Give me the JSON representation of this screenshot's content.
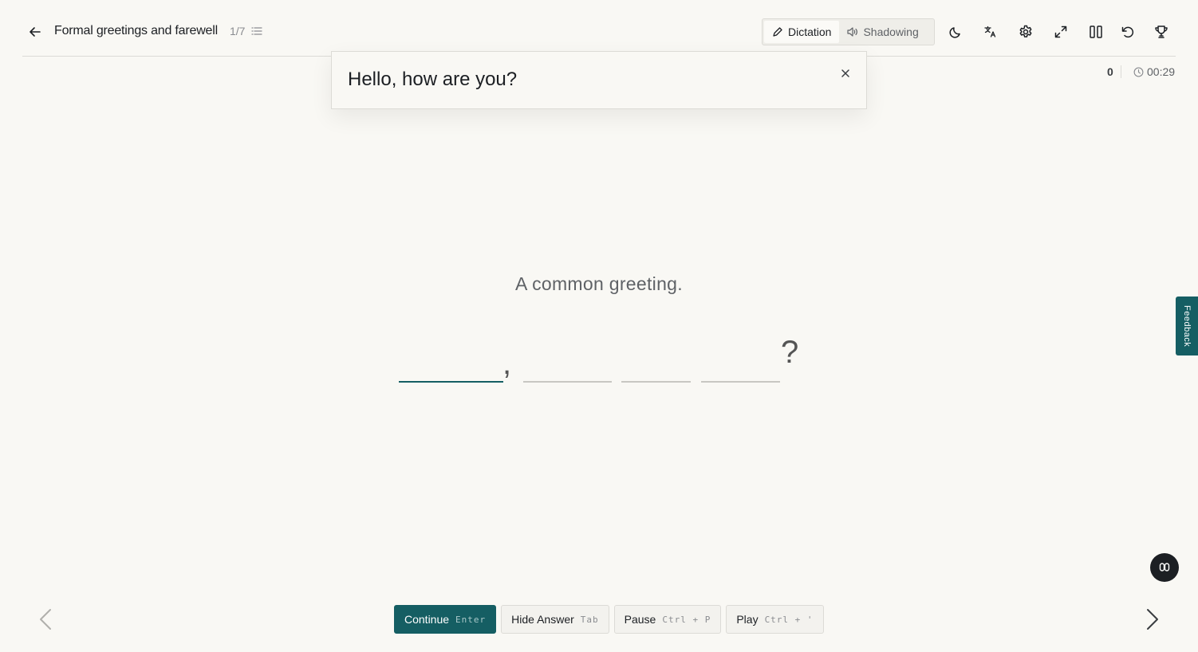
{
  "header": {
    "title": "Formal greetings and farewell",
    "progress": "1/7",
    "modes": [
      {
        "label": "Dictation",
        "icon": "pencil-icon",
        "active": true
      },
      {
        "label": "Shadowing",
        "icon": "speaker-icon",
        "active": false
      }
    ],
    "tools": [
      "moon-icon",
      "translate-icon",
      "gear-icon",
      "expand-icon",
      "columns-icon",
      "undo-icon",
      "trophy-icon"
    ]
  },
  "status": {
    "score": "0",
    "timer": "00:29"
  },
  "answer_popup": {
    "text": "Hello, how are you?"
  },
  "prompt": {
    "hint": "A common greeting.",
    "comma": ",",
    "question_mark": "?"
  },
  "controls": {
    "continue": {
      "label": "Continue",
      "shortcut": "Enter"
    },
    "hide_answer": {
      "label": "Hide Answer",
      "shortcut": "Tab"
    },
    "pause": {
      "label": "Pause",
      "shortcut": "Ctrl + P"
    },
    "play": {
      "label": "Play",
      "shortcut": "Ctrl + '"
    }
  },
  "feedback": {
    "label": "Feedback"
  },
  "colors": {
    "accent": "#155e63",
    "background": "#f9f8f4"
  }
}
